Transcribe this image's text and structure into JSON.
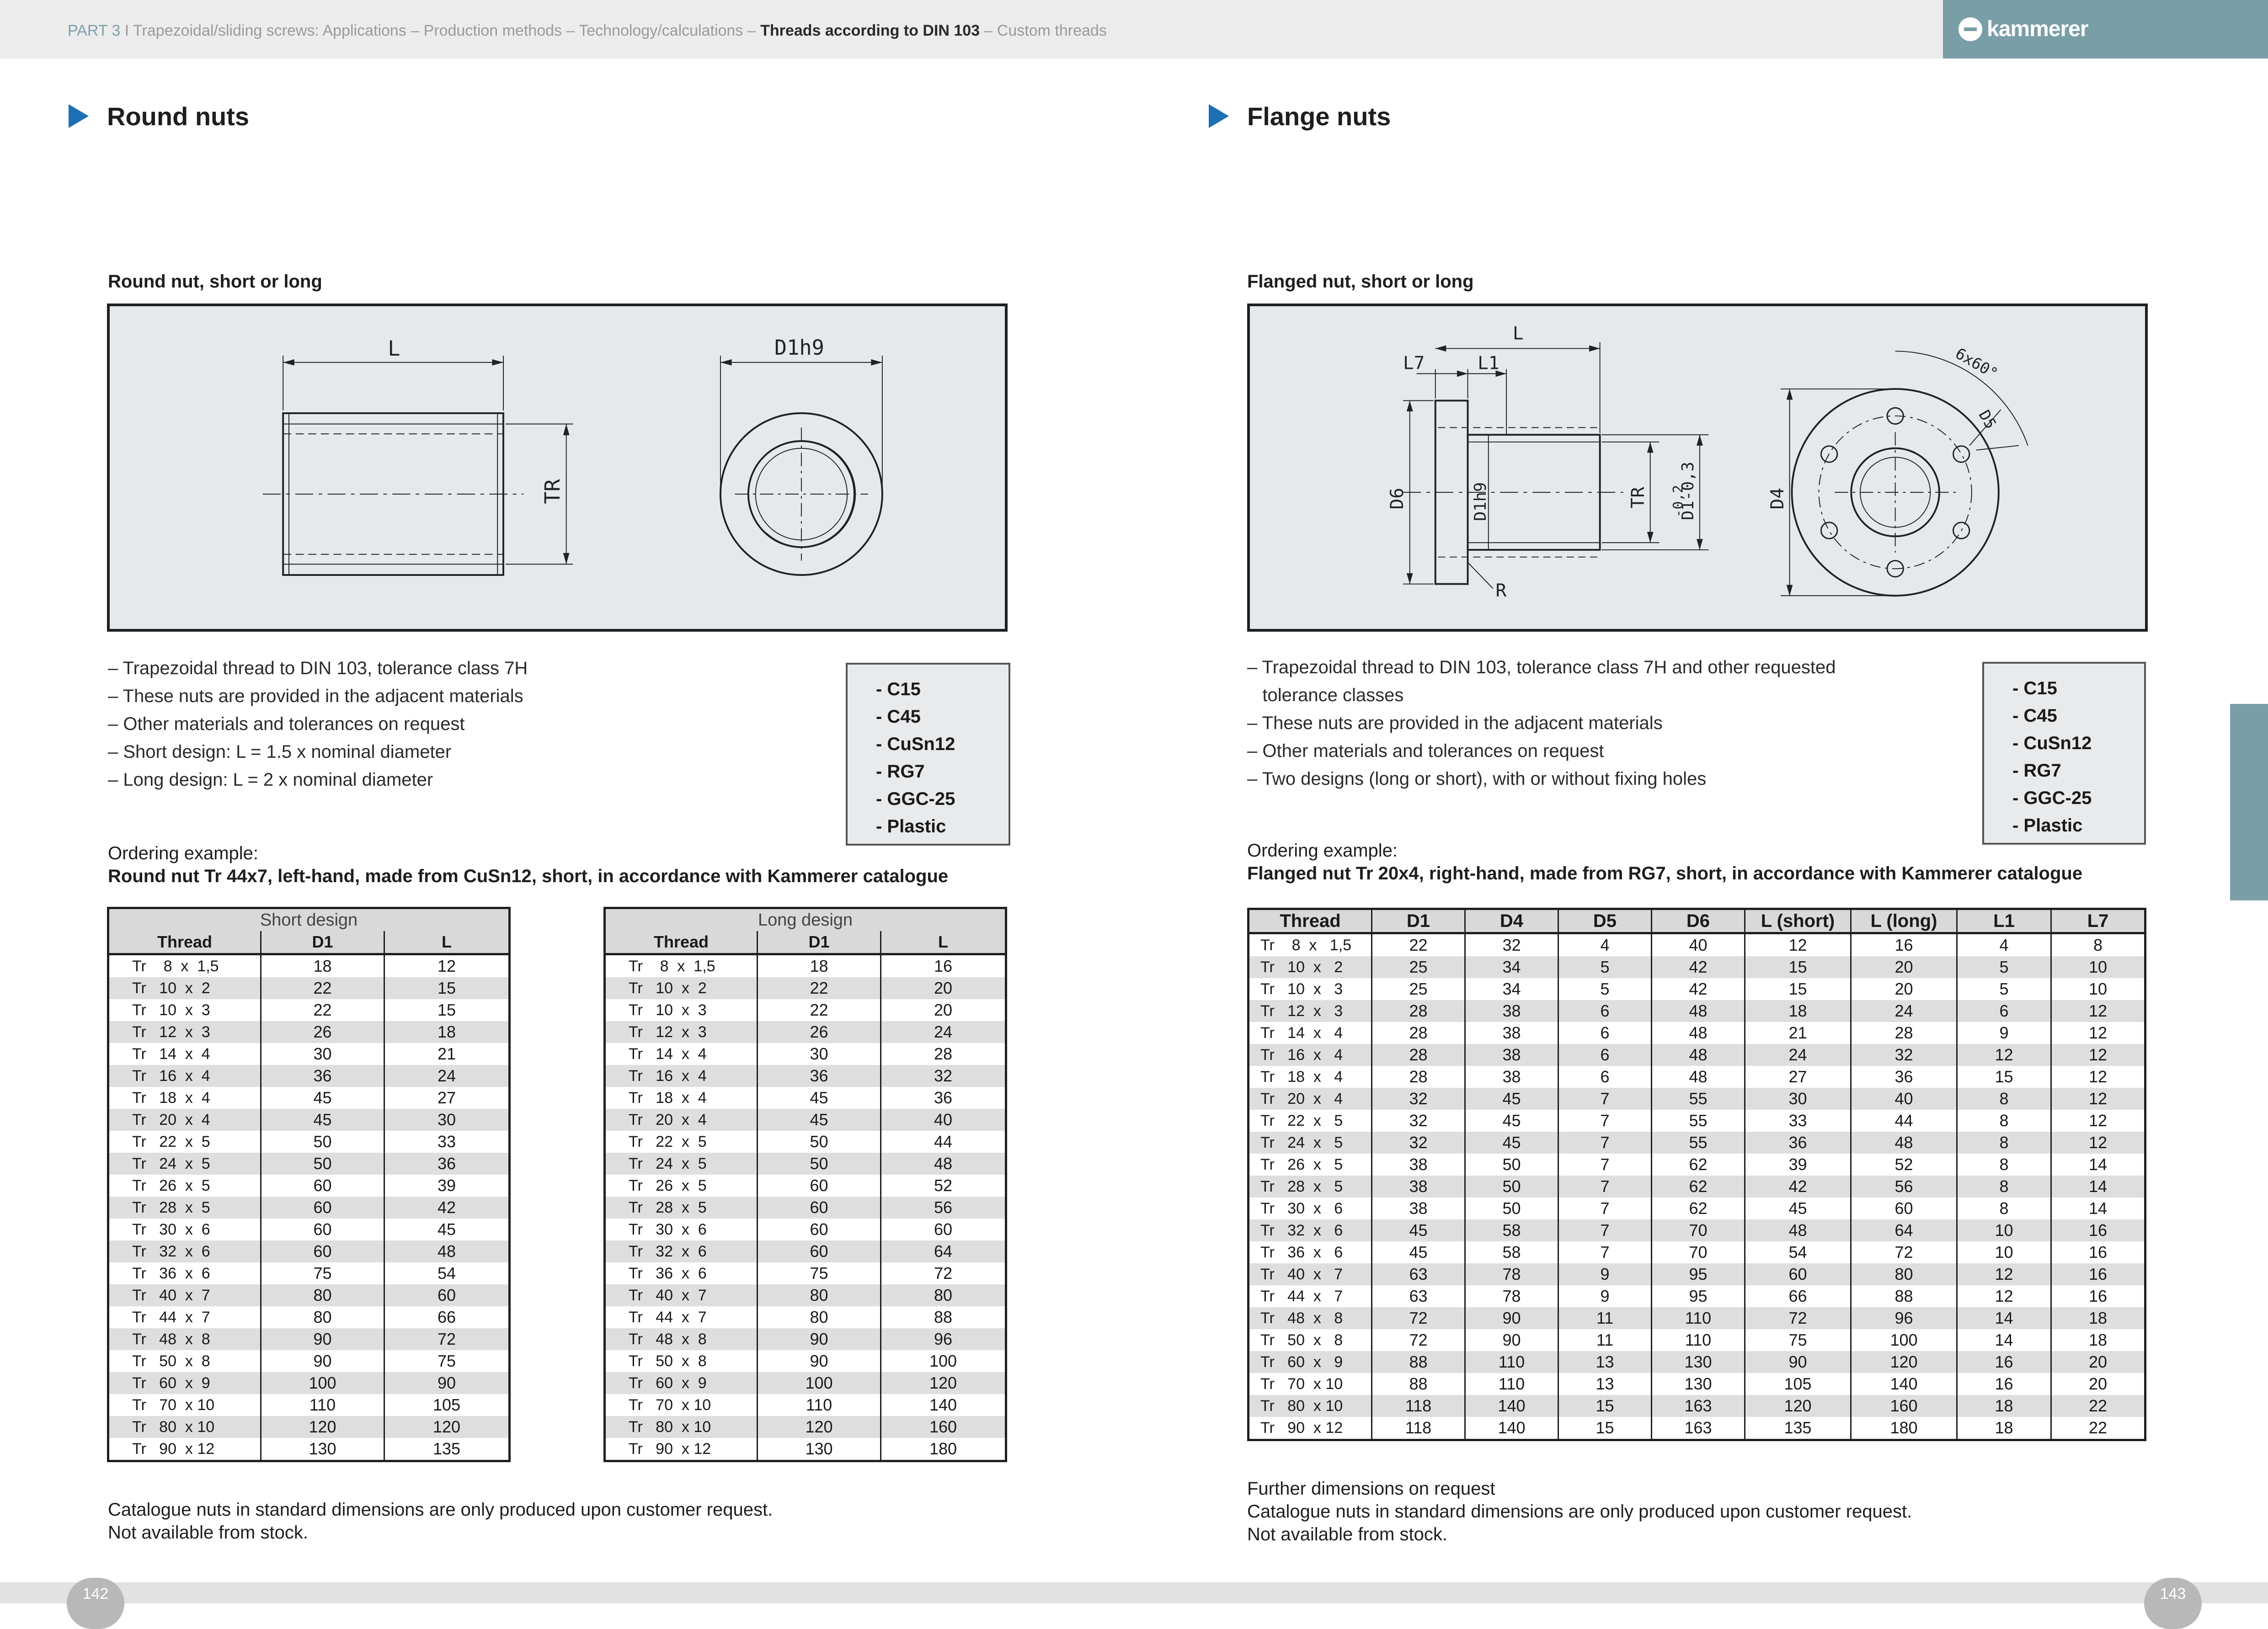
{
  "header": {
    "part": "PART 3",
    "separator": "I",
    "crumbs": "Trapezoidal/sliding screws: Applications – Production methods – Technology/calculations – ",
    "current": "Threads according to DIN 103",
    "tail": " – Custom threads",
    "logo": "kammerer"
  },
  "left": {
    "title": "Round nuts",
    "subtitle": "Round nut, short or long",
    "bullets": [
      "– Trapezoidal thread to DIN 103, tolerance class 7H",
      "– These nuts are provided in the adjacent materials",
      "– Other materials and tolerances on request",
      "– Short design: L = 1.5 x nominal diameter",
      "– Long design: L = 2 x nominal diameter"
    ],
    "materials": [
      "- C15",
      "- C45",
      "- CuSn12",
      "- RG7",
      "- GGC-25",
      "- Plastic"
    ],
    "order_lead": "Ordering example:",
    "order_example": "Round nut Tr 44x7, left-hand, made from CuSn12, short, in accordance with Kammerer catalogue",
    "short_table": {
      "group": "Short design",
      "headers": [
        "Thread",
        "D1",
        "L"
      ],
      "rows": [
        [
          "Tr    8  x  1,5",
          "18",
          "12"
        ],
        [
          "Tr   10  x  2",
          "22",
          "15"
        ],
        [
          "Tr   10  x  3",
          "22",
          "15"
        ],
        [
          "Tr   12  x  3",
          "26",
          "18"
        ],
        [
          "Tr   14  x  4",
          "30",
          "21"
        ],
        [
          "Tr   16  x  4",
          "36",
          "24"
        ],
        [
          "Tr   18  x  4",
          "45",
          "27"
        ],
        [
          "Tr   20  x  4",
          "45",
          "30"
        ],
        [
          "Tr   22  x  5",
          "50",
          "33"
        ],
        [
          "Tr   24  x  5",
          "50",
          "36"
        ],
        [
          "Tr   26  x  5",
          "60",
          "39"
        ],
        [
          "Tr   28  x  5",
          "60",
          "42"
        ],
        [
          "Tr   30  x  6",
          "60",
          "45"
        ],
        [
          "Tr   32  x  6",
          "60",
          "48"
        ],
        [
          "Tr   36  x  6",
          "75",
          "54"
        ],
        [
          "Tr   40  x  7",
          "80",
          "60"
        ],
        [
          "Tr   44  x  7",
          "80",
          "66"
        ],
        [
          "Tr   48  x  8",
          "90",
          "72"
        ],
        [
          "Tr   50  x  8",
          "90",
          "75"
        ],
        [
          "Tr   60  x  9",
          "100",
          "90"
        ],
        [
          "Tr   70  x 10",
          "110",
          "105"
        ],
        [
          "Tr   80  x 10",
          "120",
          "120"
        ],
        [
          "Tr   90  x 12",
          "130",
          "135"
        ]
      ]
    },
    "long_table": {
      "group": "Long design",
      "headers": [
        "Thread",
        "D1",
        "L"
      ],
      "rows": [
        [
          "Tr    8  x  1,5",
          "18",
          "16"
        ],
        [
          "Tr   10  x  2",
          "22",
          "20"
        ],
        [
          "Tr   10  x  3",
          "22",
          "20"
        ],
        [
          "Tr   12  x  3",
          "26",
          "24"
        ],
        [
          "Tr   14  x  4",
          "30",
          "28"
        ],
        [
          "Tr   16  x  4",
          "36",
          "32"
        ],
        [
          "Tr   18  x  4",
          "45",
          "36"
        ],
        [
          "Tr   20  x  4",
          "45",
          "40"
        ],
        [
          "Tr   22  x  5",
          "50",
          "44"
        ],
        [
          "Tr   24  x  5",
          "50",
          "48"
        ],
        [
          "Tr   26  x  5",
          "60",
          "52"
        ],
        [
          "Tr   28  x  5",
          "60",
          "56"
        ],
        [
          "Tr   30  x  6",
          "60",
          "60"
        ],
        [
          "Tr   32  x  6",
          "60",
          "64"
        ],
        [
          "Tr   36  x  6",
          "75",
          "72"
        ],
        [
          "Tr   40  x  7",
          "80",
          "80"
        ],
        [
          "Tr   44  x  7",
          "80",
          "88"
        ],
        [
          "Tr   48  x  8",
          "90",
          "96"
        ],
        [
          "Tr   50  x  8",
          "90",
          "100"
        ],
        [
          "Tr   60  x  9",
          "100",
          "120"
        ],
        [
          "Tr   70  x 10",
          "110",
          "140"
        ],
        [
          "Tr   80  x 10",
          "120",
          "160"
        ],
        [
          "Tr   90  x 12",
          "130",
          "180"
        ]
      ]
    },
    "note_1": "Catalogue nuts in standard dimensions are only produced upon customer request.",
    "note_2": "Not available from stock.",
    "page": "142",
    "drawing": {
      "label_L": "L",
      "label_TR": "TR",
      "label_D1": "D1h9"
    }
  },
  "right": {
    "title": "Flange nuts",
    "subtitle": "Flanged nut, short or long",
    "bullets": [
      "– Trapezoidal thread to DIN 103, tolerance class 7H and other requested",
      "   tolerance classes",
      "– These nuts are provided in the adjacent materials",
      "– Other materials and tolerances on request",
      "– Two designs (long or short), with or without fixing holes"
    ],
    "materials": [
      "- C15",
      "- C45",
      "- CuSn12",
      "- RG7",
      "- GGC-25",
      "- Plastic"
    ],
    "order_lead": "Ordering example:",
    "order_example": "Flanged nut Tr 20x4, right-hand, made from RG7, short, in accordance with Kammerer catalogue",
    "table": {
      "headers": [
        "Thread",
        "D1",
        "D4",
        "D5",
        "D6",
        "L (short)",
        "L (long)",
        "L1",
        "L7"
      ],
      "rows": [
        [
          "Tr    8  x   1,5",
          "22",
          "32",
          "4",
          "40",
          "12",
          "16",
          "4",
          "8"
        ],
        [
          "Tr   10  x   2",
          "25",
          "34",
          "5",
          "42",
          "15",
          "20",
          "5",
          "10"
        ],
        [
          "Tr   10  x   3",
          "25",
          "34",
          "5",
          "42",
          "15",
          "20",
          "5",
          "10"
        ],
        [
          "Tr   12  x   3",
          "28",
          "38",
          "6",
          "48",
          "18",
          "24",
          "6",
          "12"
        ],
        [
          "Tr   14  x   4",
          "28",
          "38",
          "6",
          "48",
          "21",
          "28",
          "9",
          "12"
        ],
        [
          "Tr   16  x   4",
          "28",
          "38",
          "6",
          "48",
          "24",
          "32",
          "12",
          "12"
        ],
        [
          "Tr   18  x   4",
          "28",
          "38",
          "6",
          "48",
          "27",
          "36",
          "15",
          "12"
        ],
        [
          "Tr   20  x   4",
          "32",
          "45",
          "7",
          "55",
          "30",
          "40",
          "8",
          "12"
        ],
        [
          "Tr   22  x   5",
          "32",
          "45",
          "7",
          "55",
          "33",
          "44",
          "8",
          "12"
        ],
        [
          "Tr   24  x   5",
          "32",
          "45",
          "7",
          "55",
          "36",
          "48",
          "8",
          "12"
        ],
        [
          "Tr   26  x   5",
          "38",
          "50",
          "7",
          "62",
          "39",
          "52",
          "8",
          "14"
        ],
        [
          "Tr   28  x   5",
          "38",
          "50",
          "7",
          "62",
          "42",
          "56",
          "8",
          "14"
        ],
        [
          "Tr   30  x   6",
          "38",
          "50",
          "7",
          "62",
          "45",
          "60",
          "8",
          "14"
        ],
        [
          "Tr   32  x   6",
          "45",
          "58",
          "7",
          "70",
          "48",
          "64",
          "10",
          "16"
        ],
        [
          "Tr   36  x   6",
          "45",
          "58",
          "7",
          "70",
          "54",
          "72",
          "10",
          "16"
        ],
        [
          "Tr   40  x   7",
          "63",
          "78",
          "9",
          "95",
          "60",
          "80",
          "12",
          "16"
        ],
        [
          "Tr   44  x   7",
          "63",
          "78",
          "9",
          "95",
          "66",
          "88",
          "12",
          "16"
        ],
        [
          "Tr   48  x   8",
          "72",
          "90",
          "11",
          "110",
          "72",
          "96",
          "14",
          "18"
        ],
        [
          "Tr   50  x   8",
          "72",
          "90",
          "11",
          "110",
          "75",
          "100",
          "14",
          "18"
        ],
        [
          "Tr   60  x   9",
          "88",
          "110",
          "13",
          "130",
          "90",
          "120",
          "16",
          "20"
        ],
        [
          "Tr   70  x 10",
          "88",
          "110",
          "13",
          "130",
          "105",
          "140",
          "16",
          "20"
        ],
        [
          "Tr   80  x 10",
          "118",
          "140",
          "15",
          "163",
          "120",
          "160",
          "18",
          "22"
        ],
        [
          "Tr   90  x 12",
          "118",
          "140",
          "15",
          "163",
          "135",
          "180",
          "18",
          "22"
        ]
      ]
    },
    "note_0": "Further dimensions on request",
    "note_1": "Catalogue nuts in standard dimensions are only produced upon customer request.",
    "note_2": "Not available from stock.",
    "page": "143",
    "drawing": {
      "label_L": "L",
      "label_L7": "L7",
      "label_L1": "L1",
      "label_D6": "D6",
      "label_D1h9": "D1h9",
      "label_TR": "TR",
      "label_D1tol": "D1-0,3",
      "label_tol": "-0,2",
      "label_D4": "D4",
      "label_D5": "D5",
      "label_R": "R",
      "label_holes": "6x60°"
    }
  }
}
